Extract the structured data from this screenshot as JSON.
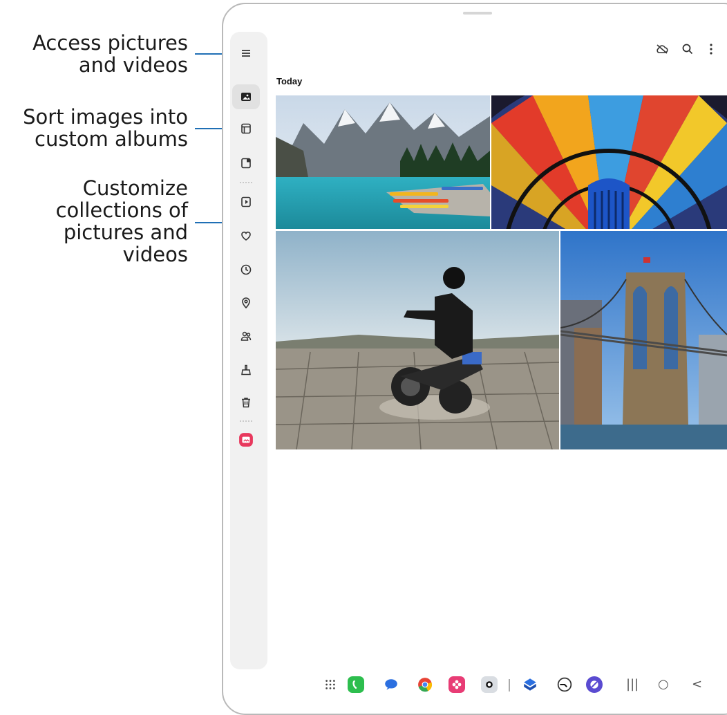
{
  "callouts": {
    "access": [
      "Access pictures",
      "and videos"
    ],
    "albums": [
      "Sort images into",
      "custom albums"
    ],
    "stories": [
      "Customize",
      "collections of",
      "pictures and",
      "videos"
    ]
  },
  "gallery": {
    "section_title": "Today",
    "photos": [
      {
        "subject": "mountain lake with canoes"
      },
      {
        "subject": "stained glass dome"
      },
      {
        "subject": "motorcyclist on cracked desert"
      },
      {
        "subject": "suspension bridge with flag"
      }
    ]
  },
  "sidebar": {
    "items": [
      "menu-icon",
      "pictures-icon",
      "albums-icon",
      "stories-icon",
      "shared-icon",
      "favorites-icon",
      "recent-icon",
      "locations-icon",
      "people-icon",
      "cleanup-icon",
      "trash-icon",
      "gallery-app-icon"
    ],
    "selected": "pictures-icon"
  },
  "toolbar": {
    "icons": [
      "cloud-off-icon",
      "search-icon",
      "more-options-icon"
    ]
  },
  "taskbar": {
    "apps": [
      "apps-grid-icon",
      "phone-icon",
      "messages-icon",
      "chrome-icon",
      "bixby-icon",
      "camera-icon",
      "store-icon",
      "clock-icon",
      "samsung-notes-icon"
    ],
    "nav": [
      "recents-icon",
      "home-icon",
      "back-icon"
    ]
  },
  "colors": {
    "leader": "#1f6fb5",
    "accent": "#e8385d"
  }
}
